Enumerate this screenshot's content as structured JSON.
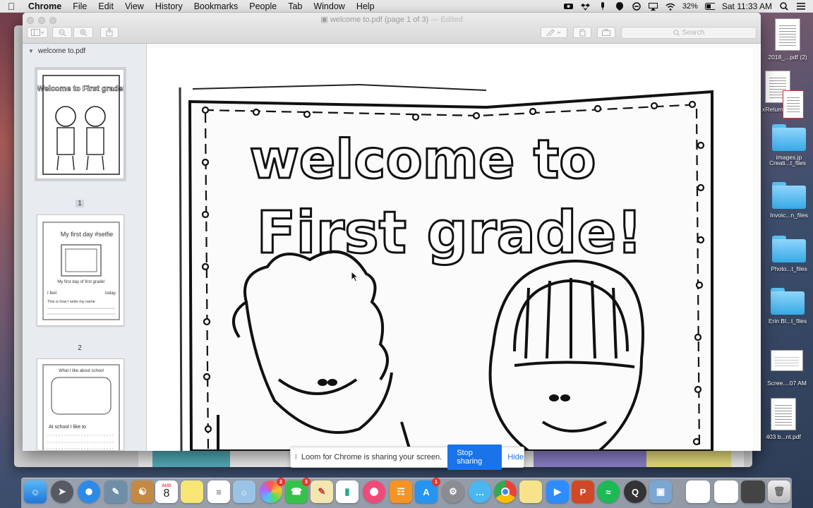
{
  "menubar": {
    "app_name": "Chrome",
    "items": [
      "File",
      "Edit",
      "View",
      "History",
      "Bookmarks",
      "People",
      "Tab",
      "Window",
      "Help"
    ],
    "battery": "32%",
    "clock": "Sat 11:33 AM"
  },
  "window": {
    "title": "welcome to.pdf (page 1 of 3)",
    "title_suffix": "— Edited",
    "search_placeholder": "Search"
  },
  "sidebar": {
    "file_name": "welcome to.pdf",
    "pages": [
      {
        "label": "1",
        "selected": true,
        "heading": "Welcome to First grade!"
      },
      {
        "label": "2",
        "selected": false,
        "heading": "My first day #selfie",
        "caption": "My first day of first grade!",
        "line1": "I feel",
        "line1b": "today.",
        "line2": "This is how I write my name"
      },
      {
        "label": "",
        "selected": false,
        "heading": "What I like about school",
        "line1": "At school I like to"
      }
    ]
  },
  "document": {
    "line1": "welcome to",
    "line2": "First grade!"
  },
  "loom": {
    "message": "Loom for Chrome is sharing your screen.",
    "stop_label": "Stop sharing",
    "hide_label": "Hide"
  },
  "desktop": [
    {
      "label": "2018_...pdf (2)",
      "kind": "doc"
    },
    {
      "label": "xReturn.pdf",
      "kind": "doc"
    },
    {
      "label": "images.jp",
      "kind": "folder"
    },
    {
      "label": "Creati...t_files",
      "kind": "folder"
    },
    {
      "label": "Invoic...n_files",
      "kind": "folder"
    },
    {
      "label": "Photo...t_files",
      "kind": "folder"
    },
    {
      "label": "Erin Bl...t_files",
      "kind": "folder"
    },
    {
      "label": "Scree....07 AM",
      "kind": "screenshot"
    },
    {
      "label": "403 b...nt.pdf",
      "kind": "doc"
    }
  ],
  "dock": {
    "calendar_month": "AUG",
    "calendar_day": "8",
    "badges": {
      "photos": "2",
      "facetime": "3",
      "appstore": "1"
    }
  },
  "colors": {
    "accent": "#1a73e8",
    "folder": "#37a9e6",
    "badge": "#e8352d"
  }
}
